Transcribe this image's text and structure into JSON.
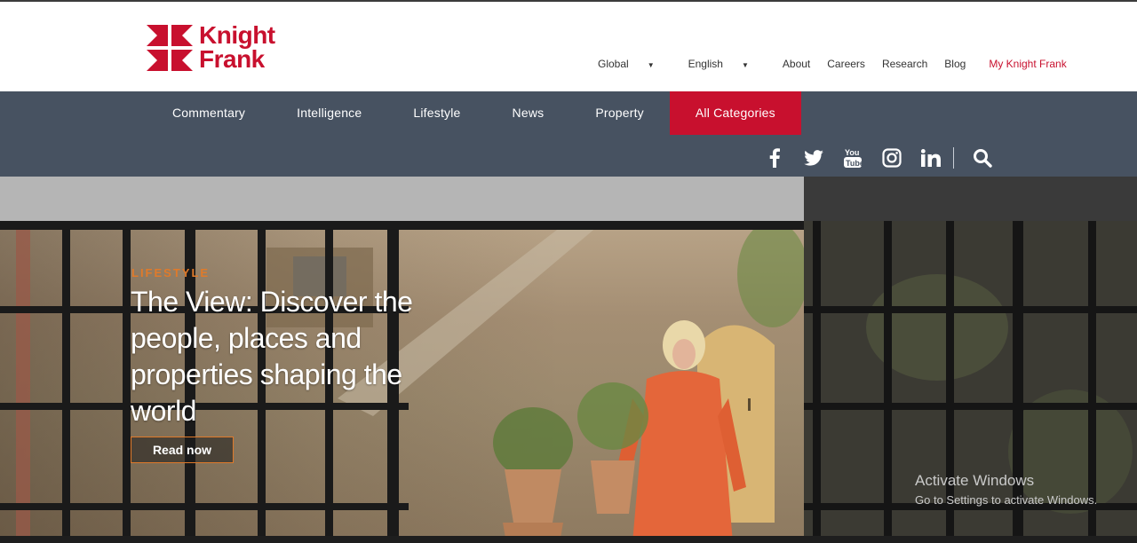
{
  "brand": {
    "line1": "Knight",
    "line2": "Frank",
    "color": "#c8102e"
  },
  "util_nav": {
    "global": "Global",
    "english": "English",
    "about": "About",
    "careers": "Careers",
    "research": "Research",
    "blog": "Blog",
    "my_knight_frank": "My Knight Frank"
  },
  "main_nav": {
    "items": [
      "Commentary",
      "Intelligence",
      "Lifestyle",
      "News",
      "Property"
    ],
    "all_categories": "All Categories",
    "bg_color": "#475261"
  },
  "social": [
    "facebook-icon",
    "twitter-icon",
    "youtube-icon",
    "instagram-icon",
    "linkedin-icon",
    "search-icon"
  ],
  "hero": {
    "kicker": "LIFESTYLE",
    "headline": "The View: Discover the people, places and properties shaping the world",
    "button": "Read now",
    "accent": "#e07a2a"
  },
  "watermark": {
    "title": "Activate Windows",
    "subtitle": "Go to Settings to activate Windows."
  }
}
